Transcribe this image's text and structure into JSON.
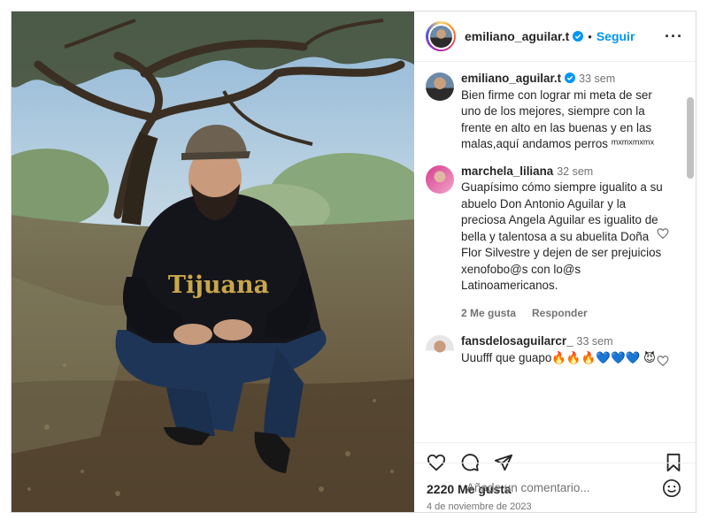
{
  "post": {
    "username": "emiliano_aguilar.t",
    "follow_label": "Seguir",
    "more_icon": "more-options-icon",
    "caption": {
      "username": "emiliano_aguilar.t",
      "time": "33 sem",
      "text": "Bien firme con lograr mi meta de ser uno de los mejores, siempre con la frente en alto en las buenas y en las malas,aquí andamos perros ᵐˣᵐˣᵐˣᵐˣ"
    },
    "comments": [
      {
        "username": "marchela_liliana",
        "time": "32 sem",
        "text": "Guapísimo cómo siempre igualito a su abuelo Don Antonio Aguilar y la preciosa Angela Aguilar es igualito de bella y talentosa a su abuelita Doña Flor Silvestre y dejen de ser prejuicios xenofobo@s con lo@s Latinoamericanos.",
        "likes": "2 Me gusta",
        "reply": "Responder"
      },
      {
        "username": "fansdelosaguilarcr_",
        "time": "33 sem",
        "text": "Uuufff que guapo🔥🔥🔥💙💙💙 😈"
      }
    ],
    "likes": "2220 Me gusta",
    "date": "4 de noviembre de 2023",
    "add_comment_placeholder": "Añade un comentario...",
    "photo_text": "Tijuana",
    "colors": {
      "accent": "#0095f6",
      "text": "#262626",
      "muted": "#737373",
      "border": "#dbdbdb",
      "hoodie_print": "#c9a64a"
    }
  }
}
